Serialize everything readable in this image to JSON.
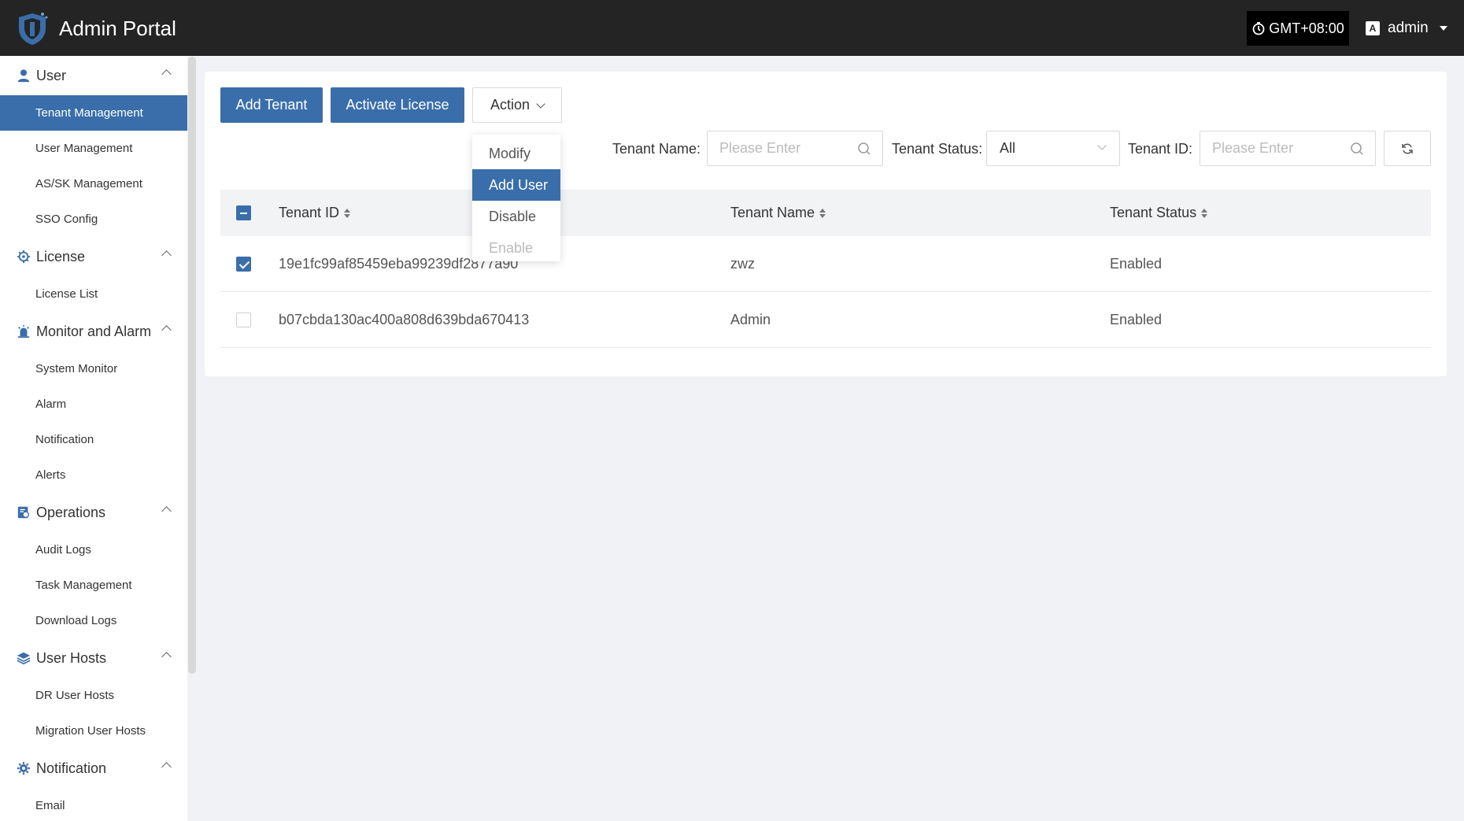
{
  "app": {
    "title": "Admin Portal"
  },
  "header": {
    "timezone": "GMT+08:00",
    "user": "admin",
    "lang_icon_text": "A"
  },
  "colors": {
    "accent": "#3a6eaa",
    "header_bg": "#242424"
  },
  "sidebar": {
    "groups": [
      {
        "label": "User",
        "icon": "user-icon",
        "items": [
          "Tenant Management",
          "User Management",
          "AS/SK Management",
          "SSO Config"
        ]
      },
      {
        "label": "License",
        "icon": "license-icon",
        "items": [
          "License List"
        ]
      },
      {
        "label": "Monitor and Alarm",
        "icon": "alarm-icon",
        "items": [
          "System Monitor",
          "Alarm",
          "Notification",
          "Alerts"
        ]
      },
      {
        "label": "Operations",
        "icon": "operations-icon",
        "items": [
          "Audit Logs",
          "Task Management",
          "Download Logs"
        ]
      },
      {
        "label": "User Hosts",
        "icon": "layers-icon",
        "items": [
          "DR User Hosts",
          "Migration User Hosts"
        ]
      },
      {
        "label": "Notification",
        "icon": "gear-icon",
        "items": [
          "Email"
        ]
      }
    ],
    "active_item": "Tenant Management"
  },
  "toolbar": {
    "add_tenant": "Add Tenant",
    "activate_license": "Activate License",
    "action": "Action",
    "action_menu": [
      "Modify",
      "Add User",
      "Disable",
      "Enable"
    ],
    "action_menu_highlighted": "Add User",
    "action_menu_disabled": "Enable"
  },
  "filters": {
    "tenant_name_label": "Tenant Name:",
    "tenant_name_placeholder": "Please Enter",
    "tenant_status_label": "Tenant Status:",
    "tenant_status_value": "All",
    "tenant_id_label": "Tenant ID:",
    "tenant_id_placeholder": "Please Enter"
  },
  "table": {
    "columns": [
      "Tenant ID",
      "Tenant Name",
      "Tenant Status"
    ],
    "rows": [
      {
        "id": "19e1fc99af85459eba99239df2877a90",
        "name": "zwz",
        "status": "Enabled",
        "checked": true
      },
      {
        "id": "b07cbda130ac400a808d639bda670413",
        "name": "Admin",
        "status": "Enabled",
        "checked": false
      }
    ]
  }
}
